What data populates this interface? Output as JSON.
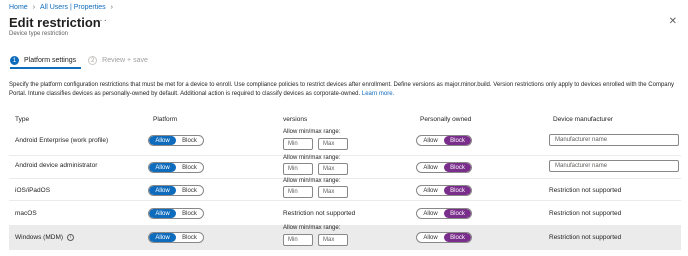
{
  "breadcrumb": [
    "Home",
    "All Users | Properties"
  ],
  "page": {
    "title": "Edit restriction",
    "more": "···",
    "subtitle": "Device type restriction",
    "close": "✕"
  },
  "steps": [
    {
      "num": "1",
      "label": "Platform settings"
    },
    {
      "num": "2",
      "label": "Review + save"
    }
  ],
  "description": {
    "text": "Specify the platform configuration restrictions that must be met for a device to enroll. Use compliance policies to restrict devices after enrollment. Define versions as major.minor.build. Version restrictions only apply to devices enrolled with the Company Portal. Intune classifies devices as personally-owned by default. Additional action is required to classify devices as corporate-owned.",
    "link": "Learn more."
  },
  "columns": {
    "type": "Type",
    "platform": "Platform",
    "versions": "versions",
    "owned": "Personally owned",
    "manufacturer": "Device manufacturer"
  },
  "toggle_labels": {
    "allow": "Allow",
    "block": "Block"
  },
  "version_labels": {
    "range": "Allow min/max range:",
    "min": "Min",
    "max": "Max"
  },
  "rows": [
    {
      "type": "Android Enterprise (work profile)",
      "platform": "Allow",
      "versions": "range",
      "owned": "Block",
      "manufacturer_placeholder": "Manufacturer name"
    },
    {
      "type": "Android device administrator",
      "platform": "Allow",
      "versions": "range",
      "owned": "Block",
      "manufacturer_placeholder": "Manufacturer name"
    },
    {
      "type": "iOS/iPadOS",
      "platform": "Allow",
      "versions": "range",
      "owned": "Block",
      "manufacturer_text": "Restriction not supported"
    },
    {
      "type": "macOS",
      "platform": "Allow",
      "versions_text": "Restriction not supported",
      "owned": "Block",
      "manufacturer_text": "Restriction not supported"
    },
    {
      "type": "Windows (MDM)",
      "platform": "Allow",
      "versions": "range",
      "owned": "Block",
      "manufacturer_text": "Restriction not supported"
    }
  ],
  "colors": {
    "accent": "#0f6cbd",
    "block_active": "#7a2e8c"
  }
}
